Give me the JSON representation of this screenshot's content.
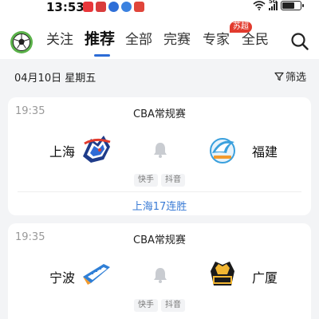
{
  "status_bar": {
    "time": "13:53",
    "network": "5G",
    "app_icon_colors": [
      "#e8363a",
      "#d93c3c",
      "#2f6fd8",
      "#3c82e0",
      "#e0453a"
    ]
  },
  "nav": {
    "tabs": [
      {
        "label": "关注",
        "active": false
      },
      {
        "label": "推荐",
        "active": true
      },
      {
        "label": "全部",
        "active": false
      },
      {
        "label": "完赛",
        "active": false
      },
      {
        "label": "专家",
        "active": false
      },
      {
        "label": "全民",
        "active": false
      }
    ],
    "badge": "苏超"
  },
  "date_bar": {
    "date": "04月10日 星期五",
    "filter_label": "筛选"
  },
  "matches": [
    {
      "time": "19:35",
      "league": "CBA常规赛",
      "home": "上海",
      "away": "福建",
      "streams": [
        "快手",
        "抖音"
      ],
      "note": "上海17连胜"
    },
    {
      "time": "19:35",
      "league": "CBA常规赛",
      "home": "宁波",
      "away": "广厦",
      "streams": [
        "快手",
        "抖音"
      ]
    }
  ],
  "colors": {
    "accent": "#2b6bd6",
    "note_text": "#3a7bd5",
    "badge_bg": "#e23b2e",
    "page_bg": "#f3f4f6"
  }
}
